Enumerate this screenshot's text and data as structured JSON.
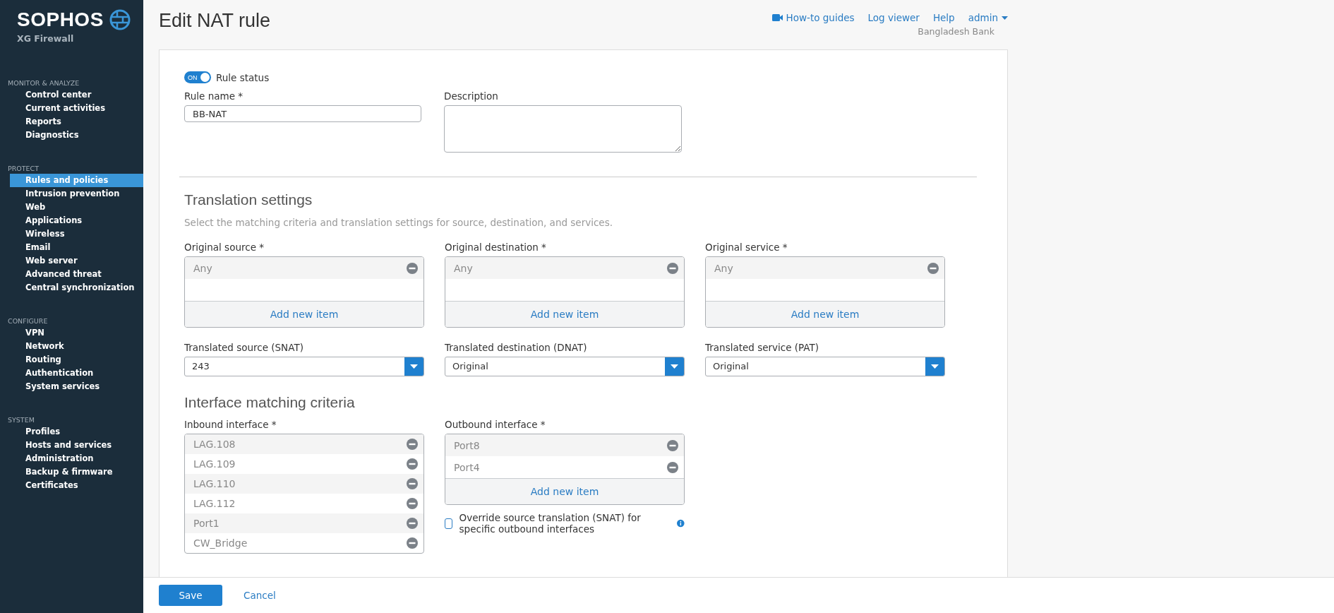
{
  "brand": {
    "name": "SOPHOS",
    "product": "XG Firewall"
  },
  "sidebar": {
    "sections": [
      {
        "title": "MONITOR & ANALYZE",
        "items": [
          {
            "label": "Control center",
            "selected": false
          },
          {
            "label": "Current activities",
            "selected": false
          },
          {
            "label": "Reports",
            "selected": false
          },
          {
            "label": "Diagnostics",
            "selected": false
          }
        ]
      },
      {
        "title": "PROTECT",
        "items": [
          {
            "label": "Rules and policies",
            "selected": true
          },
          {
            "label": "Intrusion prevention",
            "selected": false
          },
          {
            "label": "Web",
            "selected": false
          },
          {
            "label": "Applications",
            "selected": false
          },
          {
            "label": "Wireless",
            "selected": false
          },
          {
            "label": "Email",
            "selected": false
          },
          {
            "label": "Web server",
            "selected": false
          },
          {
            "label": "Advanced threat",
            "selected": false
          },
          {
            "label": "Central synchronization",
            "selected": false
          }
        ]
      },
      {
        "title": "CONFIGURE",
        "items": [
          {
            "label": "VPN",
            "selected": false
          },
          {
            "label": "Network",
            "selected": false
          },
          {
            "label": "Routing",
            "selected": false
          },
          {
            "label": "Authentication",
            "selected": false
          },
          {
            "label": "System services",
            "selected": false
          }
        ]
      },
      {
        "title": "SYSTEM",
        "items": [
          {
            "label": "Profiles",
            "selected": false
          },
          {
            "label": "Hosts and services",
            "selected": false
          },
          {
            "label": "Administration",
            "selected": false
          },
          {
            "label": "Backup & firmware",
            "selected": false
          },
          {
            "label": "Certificates",
            "selected": false
          }
        ]
      }
    ]
  },
  "header": {
    "title": "Edit NAT rule",
    "links": [
      {
        "label": "How-to guides",
        "kind": "video"
      },
      {
        "label": "Log viewer",
        "kind": "plain"
      },
      {
        "label": "Help",
        "kind": "plain"
      }
    ],
    "user": "admin",
    "organization": "Bangladesh Bank"
  },
  "form": {
    "rule_status": {
      "badge": "ON",
      "label": "Rule status",
      "on": true
    },
    "rule_name": {
      "label": "Rule name *",
      "value": "BB-NAT"
    },
    "description": {
      "label": "Description"
    }
  },
  "translation": {
    "heading": "Translation settings",
    "subtitle": "Select the matching criteria and translation settings for source, destination, and services.",
    "original": [
      {
        "label": "Original source *",
        "items": [
          "Any"
        ],
        "add_label": "Add new item"
      },
      {
        "label": "Original destination *",
        "items": [
          "Any"
        ],
        "add_label": "Add new item"
      },
      {
        "label": "Original service *",
        "items": [
          "Any"
        ],
        "add_label": "Add new item"
      }
    ],
    "translated": [
      {
        "label": "Translated source (SNAT)",
        "value": "243"
      },
      {
        "label": "Translated destination (DNAT)",
        "value": "Original"
      },
      {
        "label": "Translated service (PAT)",
        "value": "Original"
      }
    ]
  },
  "interface": {
    "heading": "Interface matching criteria",
    "inbound": {
      "label": "Inbound interface *",
      "items": [
        "LAG.108",
        "LAG.109",
        "LAG.110",
        "LAG.112",
        "Port1",
        "CW_Bridge"
      ]
    },
    "outbound": {
      "label": "Outbound interface *",
      "items": [
        "Port8",
        "Port4"
      ],
      "add_label": "Add new item"
    },
    "override": {
      "label": "Override source translation (SNAT) for specific outbound interfaces",
      "checked": false
    }
  },
  "footer": {
    "save": "Save",
    "cancel": "Cancel"
  }
}
